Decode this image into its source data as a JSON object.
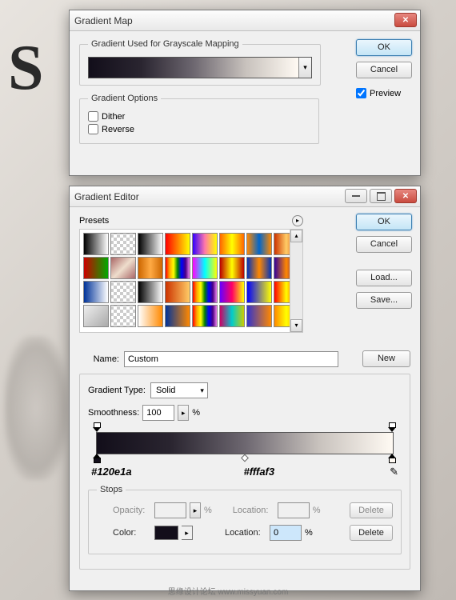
{
  "gradientMap": {
    "title": "Gradient Map",
    "group1": "Gradient Used for Grayscale Mapping",
    "group2": "Gradient Options",
    "dither": "Dither",
    "reverse": "Reverse",
    "ok": "OK",
    "cancel": "Cancel",
    "preview": "Preview"
  },
  "gradientEditor": {
    "title": "Gradient Editor",
    "presets": "Presets",
    "ok": "OK",
    "cancel": "Cancel",
    "load": "Load...",
    "save": "Save...",
    "nameLabel": "Name:",
    "nameValue": "Custom",
    "new": "New",
    "gradientTypeLabel": "Gradient Type:",
    "gradientTypeValue": "Solid",
    "smoothnessLabel": "Smoothness:",
    "smoothnessValue": "100",
    "percent": "%",
    "stopsLegend": "Stops",
    "opacityLabel": "Opacity:",
    "locationLabel": "Location:",
    "locationValue": "0",
    "deleteLabel": "Delete",
    "colorLabel": "Color:",
    "leftHex": "#120e1a",
    "rightHex": "#fffaf3"
  },
  "presetColors": [
    "linear-gradient(90deg,#000,#fff)",
    "repeating-conic-gradient(#ccc 0% 25%,#fff 0% 50%) 50%/8px 8px",
    "linear-gradient(90deg,#000,#fff)",
    "linear-gradient(90deg,#f00,#ff0)",
    "linear-gradient(90deg,#30f,#f7a,#ff0)",
    "linear-gradient(90deg,#f60,#ff0,#f60)",
    "linear-gradient(90deg,#f80,#06c,#f80)",
    "linear-gradient(90deg,#c30,#fc6,#c30)",
    "linear-gradient(90deg,#c00,#0a0)",
    "linear-gradient(135deg,#a66,#edc,#a66)",
    "linear-gradient(90deg,#c60,#fa4,#c60)",
    "linear-gradient(90deg,red,orange,yellow,green,blue,indigo,violet)",
    "linear-gradient(90deg,#f0f,#0ff,#ff0)",
    "linear-gradient(90deg,#b00,#ff0,#b00)",
    "linear-gradient(90deg,#03b,#f80,#03b)",
    "linear-gradient(90deg,#309,#f80,#309)",
    "linear-gradient(90deg,#039,#fff)",
    "repeating-conic-gradient(#ccc 0% 25%,#fff 0% 50%) 50%/8px 8px",
    "linear-gradient(90deg,#000,#fff)",
    "linear-gradient(90deg,#c30,#fc6)",
    "linear-gradient(90deg,red,orange,yellow,green,blue,indigo,violet)",
    "linear-gradient(90deg,#60f,#f06,#ff0)",
    "linear-gradient(90deg,#00f,#ff0)",
    "linear-gradient(90deg,#f00,#ff0,#f00)",
    "linear-gradient(135deg,#eee,#aaa)",
    "repeating-conic-gradient(#ccc 0% 25%,#fff 0% 50%) 50%/8px 8px",
    "linear-gradient(90deg,#fff,#f80)",
    "linear-gradient(90deg,#039,#f80)",
    "linear-gradient(90deg,red,orange,yellow,green,blue,indigo,violet)",
    "linear-gradient(90deg,#c06,#0cc,#cc0)",
    "linear-gradient(90deg,#33c,#f80)",
    "linear-gradient(90deg,#f80,#ff0,#f80)"
  ],
  "footer": "思缘设计论坛   www.missyuan.com"
}
